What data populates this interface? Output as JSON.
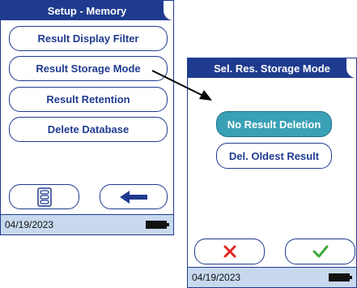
{
  "left_screen": {
    "title": "Setup - Memory",
    "menu": [
      {
        "label": "Result Display Filter"
      },
      {
        "label": "Result Storage Mode"
      },
      {
        "label": "Result Retention"
      },
      {
        "label": "Delete Database"
      }
    ],
    "buttons": {
      "menu_icon": "list-icon",
      "back_icon": "back-arrow-icon"
    },
    "footer": {
      "date": "04/19/2023",
      "battery_icon": "battery-icon"
    }
  },
  "right_screen": {
    "title": "Sel. Res. Storage Mode",
    "options": [
      {
        "label": "No Result Deletion",
        "selected": true
      },
      {
        "label": "Del. Oldest Result",
        "selected": false
      }
    ],
    "buttons": {
      "cancel_icon": "x-icon",
      "confirm_icon": "checkmark-icon"
    },
    "footer": {
      "date": "04/19/2023",
      "battery_icon": "battery-icon"
    }
  },
  "colors": {
    "brand_blue": "#1f3b8f",
    "selected_teal": "#3aa0b6",
    "footer_bg": "#c8d9ef",
    "cancel_red": "#e52521",
    "confirm_green": "#3aa83a"
  },
  "connector": {
    "icon": "pointer-arrow-icon"
  }
}
